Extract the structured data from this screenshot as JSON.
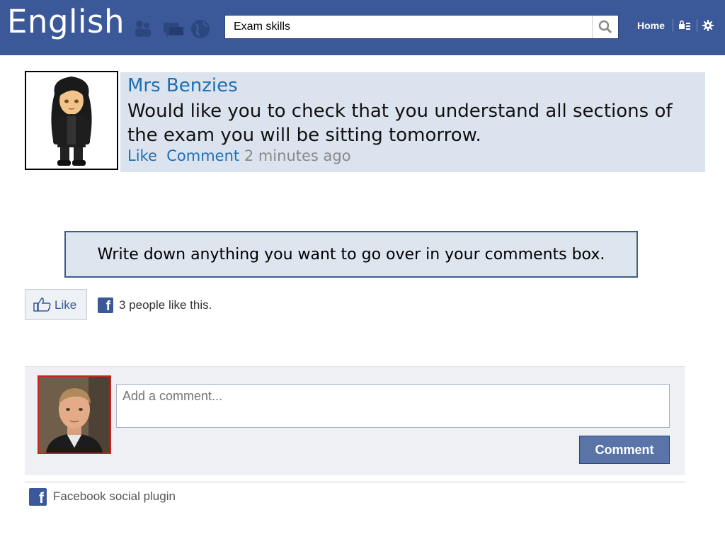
{
  "header": {
    "brand": "English",
    "search_value": "Exam skills",
    "home_label": "Home",
    "icons": [
      "friends-icon",
      "messages-icon",
      "notifications-globe-icon",
      "search-icon",
      "privacy-icon",
      "settings-gear-icon"
    ],
    "bar_color": "#3b5998"
  },
  "post": {
    "author": "Mrs Benzies",
    "text": "Would like you to check that you understand all sections of the exam you will be sitting tomorrow.",
    "like_label": "Like",
    "comment_label": "Comment",
    "timestamp": "2 minutes ago",
    "link_color": "#1f6fb2",
    "background": "#dbe3ee"
  },
  "instruction": {
    "text": "Write down anything you want to go over in your comments box."
  },
  "like_bar": {
    "button_label": "Like",
    "count_text": "3 people like this."
  },
  "comment_box": {
    "placeholder": "Add a comment...",
    "button_label": "Comment"
  },
  "footer": {
    "plugin_label": "Facebook social plugin"
  }
}
